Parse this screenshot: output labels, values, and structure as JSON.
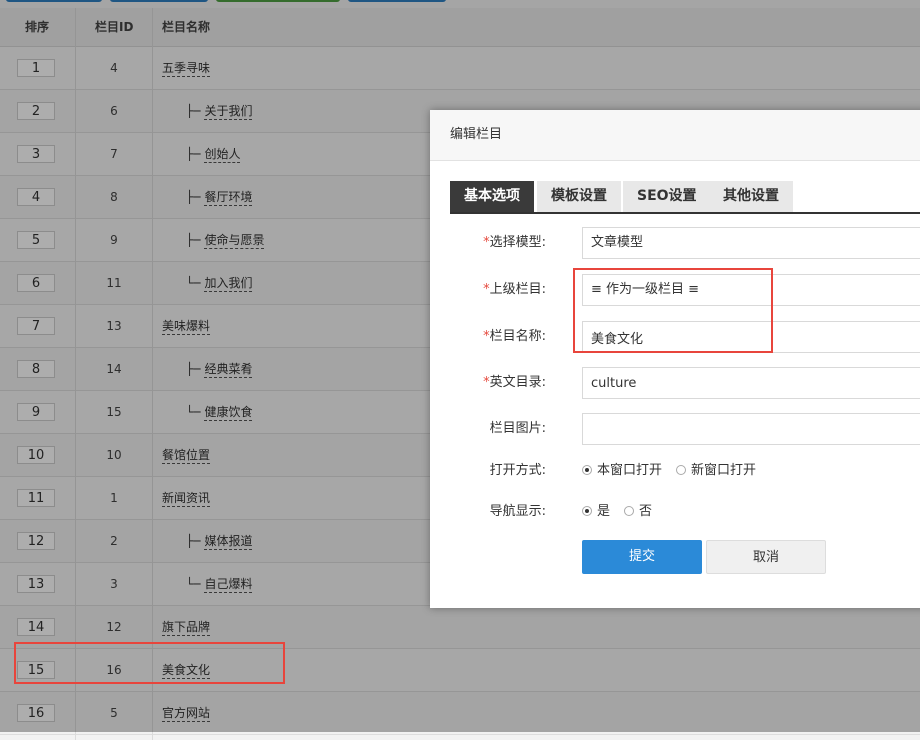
{
  "table": {
    "headers": {
      "sort": "排序",
      "id": "栏目ID",
      "name": "栏目名称"
    },
    "rows": [
      {
        "sort": "1",
        "id": "4",
        "name": "五季寻味",
        "tree": ""
      },
      {
        "sort": "2",
        "id": "6",
        "name": "关于我们",
        "tree": "├─"
      },
      {
        "sort": "3",
        "id": "7",
        "name": "创始人",
        "tree": "├─"
      },
      {
        "sort": "4",
        "id": "8",
        "name": "餐厅环境",
        "tree": "├─"
      },
      {
        "sort": "5",
        "id": "9",
        "name": "使命与愿景",
        "tree": "├─"
      },
      {
        "sort": "6",
        "id": "11",
        "name": "加入我们",
        "tree": "└─"
      },
      {
        "sort": "7",
        "id": "13",
        "name": "美味爆料",
        "tree": ""
      },
      {
        "sort": "8",
        "id": "14",
        "name": "经典菜肴",
        "tree": "├─"
      },
      {
        "sort": "9",
        "id": "15",
        "name": "健康饮食",
        "tree": "└─"
      },
      {
        "sort": "10",
        "id": "10",
        "name": "餐馆位置",
        "tree": ""
      },
      {
        "sort": "11",
        "id": "1",
        "name": "新闻资讯",
        "tree": ""
      },
      {
        "sort": "12",
        "id": "2",
        "name": "媒体报道",
        "tree": "├─"
      },
      {
        "sort": "13",
        "id": "3",
        "name": "自己爆料",
        "tree": "└─"
      },
      {
        "sort": "14",
        "id": "12",
        "name": "旗下品牌",
        "tree": ""
      },
      {
        "sort": "15",
        "id": "16",
        "name": "美食文化",
        "tree": ""
      },
      {
        "sort": "16",
        "id": "5",
        "name": "官方网站",
        "tree": ""
      }
    ]
  },
  "dialog": {
    "title": "编辑栏目",
    "tabs": [
      "基本选项",
      "模板设置",
      "SEO设置",
      "其他设置"
    ],
    "fields": {
      "model": {
        "label": "选择模型:",
        "value": "文章模型",
        "required": true
      },
      "parent": {
        "label": "上级栏目:",
        "value": "≡ 作为一级栏目 ≡",
        "required": true
      },
      "name": {
        "label": "栏目名称:",
        "value": "美食文化",
        "required": true
      },
      "dir": {
        "label": "英文目录:",
        "value": "culture",
        "required": true
      },
      "image": {
        "label": "栏目图片:",
        "value": "",
        "required": false
      },
      "open_mode": {
        "label": "打开方式:",
        "options": [
          "本窗口打开",
          "新窗口打开"
        ],
        "selected": 0
      },
      "nav_show": {
        "label": "导航显示:",
        "options": [
          "是",
          "否"
        ],
        "selected": 0
      }
    },
    "submit_label": "提交",
    "cancel_label": "取消",
    "required_mark": "*"
  },
  "colors": {
    "primary": "#2b8ad8",
    "highlight": "#e8453c",
    "tab_active": "#3a3a3a"
  }
}
